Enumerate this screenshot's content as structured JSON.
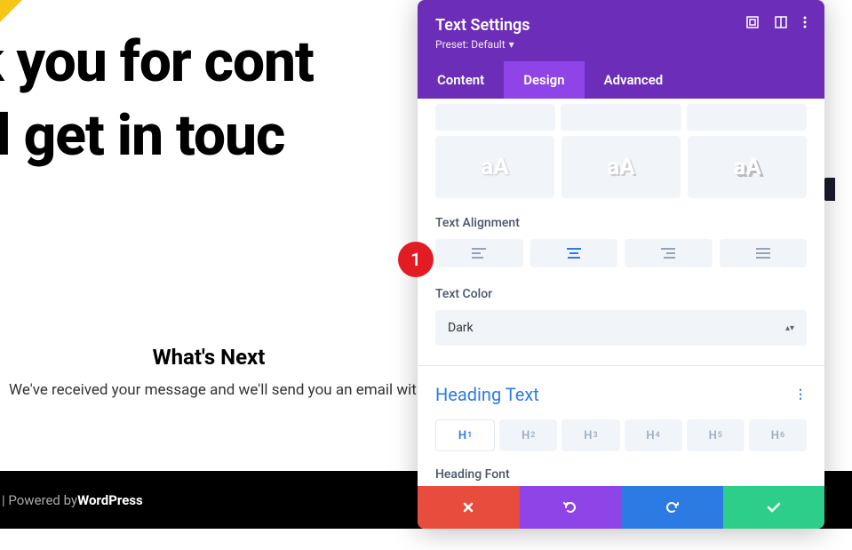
{
  "bg": {
    "line1": "k you for cont",
    "line2": "'ll get in touc",
    "whatsNext": "What's Next",
    "received": "We've received your message and we'll send you an email with",
    "footerPrefix": " | Powered by ",
    "footerBrand": "WordPress"
  },
  "panel": {
    "title": "Text Settings",
    "preset": "Preset: Default",
    "tabs": {
      "content": "Content",
      "design": "Design",
      "advanced": "Advanced"
    },
    "textAlignment": "Text Alignment",
    "textColor": "Text Color",
    "colorValue": "Dark",
    "headingText": "Heading Text",
    "headingFont": "Heading Font",
    "hlevels": [
      "H1",
      "H2",
      "H3",
      "H4",
      "H5",
      "H6"
    ],
    "aa": "aA"
  },
  "marker": "1"
}
